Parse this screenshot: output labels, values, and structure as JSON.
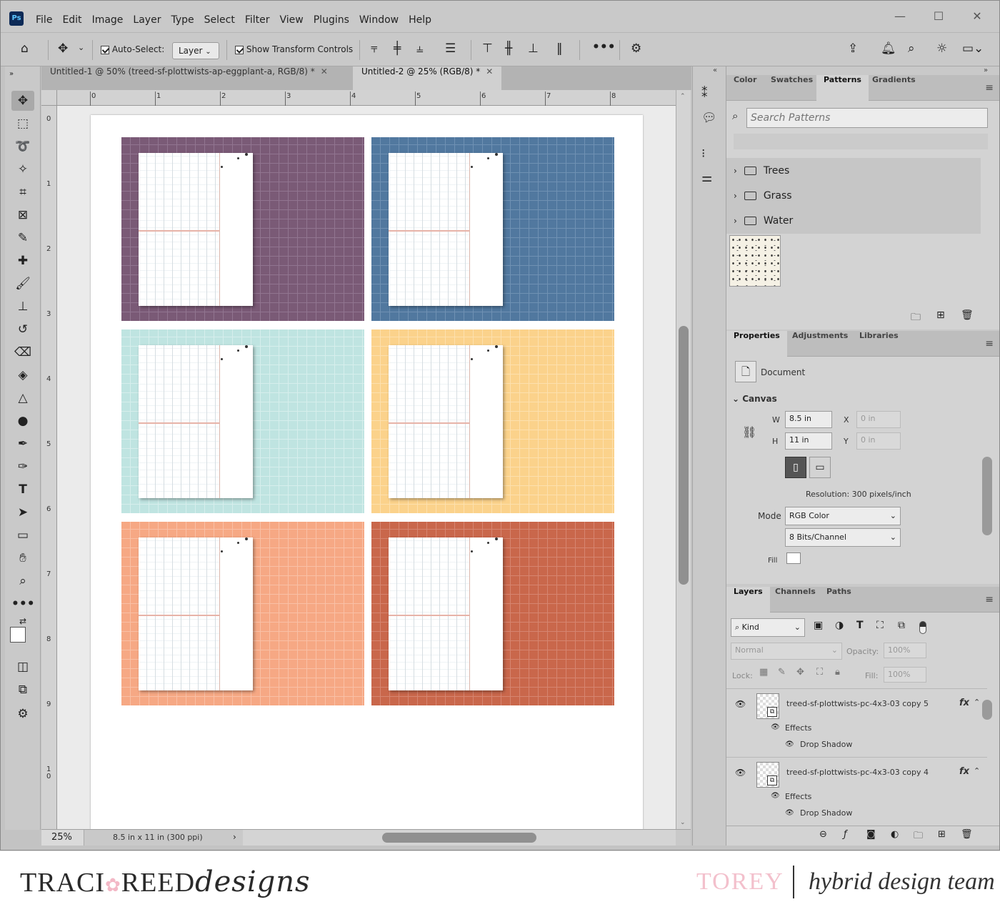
{
  "app": {
    "logo": "Ps",
    "minimize": "—",
    "maximize": "☐",
    "close": "✕"
  },
  "menu": [
    "File",
    "Edit",
    "Image",
    "Layer",
    "Type",
    "Select",
    "Filter",
    "View",
    "Plugins",
    "Window",
    "Help"
  ],
  "options_bar": {
    "auto_select_label": "Auto-Select:",
    "auto_select_checked": true,
    "auto_select_value": "Layer",
    "show_transform_label": "Show Transform Controls",
    "show_transform_checked": true
  },
  "doc_tabs": [
    {
      "label": "Untitled-1 @ 50% (treed-sf-plottwists-ap-eggplant-a, RGB/8) *",
      "active": false
    },
    {
      "label": "Untitled-2 @ 25% (RGB/8) *",
      "active": true
    }
  ],
  "rulers": {
    "h": [
      "0",
      "1",
      "2",
      "3",
      "4",
      "5",
      "6",
      "7",
      "8"
    ],
    "v": [
      "0",
      "1",
      "2",
      "3",
      "4",
      "5",
      "6",
      "7",
      "8",
      "9",
      "1\n0"
    ]
  },
  "cards": [
    {
      "name": "eggplant",
      "bg": "#7a5a76",
      "line": "#917590"
    },
    {
      "name": "blue",
      "bg": "#51789f",
      "line": "#6f91b3"
    },
    {
      "name": "mint",
      "bg": "#bfe4e1",
      "line": "#d6eeec"
    },
    {
      "name": "yellow",
      "bg": "#fbd28b",
      "line": "#fde0ae"
    },
    {
      "name": "peach",
      "bg": "#f6a884",
      "line": "#f9c0a6"
    },
    {
      "name": "rust",
      "bg": "#c9674b",
      "line": "#d68570"
    }
  ],
  "status": {
    "zoom": "25%",
    "doc_info": "8.5 in x 11 in (300 ppi)"
  },
  "color_panel": {
    "tabs": [
      "Color",
      "Swatches",
      "Patterns",
      "Gradients"
    ],
    "active_tab": "Patterns",
    "search_placeholder": "Search Patterns",
    "folders": [
      "Trees",
      "Grass",
      "Water"
    ]
  },
  "properties_panel": {
    "tabs": [
      "Properties",
      "Adjustments",
      "Libraries"
    ],
    "active_tab": "Properties",
    "document_label": "Document",
    "canvas_label": "Canvas",
    "w_label": "W",
    "w_value": "8.5 in",
    "h_label": "H",
    "h_value": "11 in",
    "x_label": "X",
    "x_value": "0 in",
    "y_label": "Y",
    "y_value": "0 in",
    "resolution": "Resolution: 300 pixels/inch",
    "mode_label": "Mode",
    "mode_value": "RGB Color",
    "bits_value": "8 Bits/Channel",
    "fill_label": "Fill"
  },
  "layers_panel": {
    "tabs": [
      "Layers",
      "Channels",
      "Paths"
    ],
    "active_tab": "Layers",
    "kind_label": "Kind",
    "blend_mode": "Normal",
    "opacity_label": "Opacity:",
    "opacity_value": "100%",
    "lock_label": "Lock:",
    "fill_label": "Fill:",
    "fill_value": "100%",
    "layers": [
      {
        "name": "treed-sf-plottwists-pc-4x3-03 copy 5",
        "effects": "Effects",
        "effect": "Drop Shadow",
        "fx": "fx"
      },
      {
        "name": "treed-sf-plottwists-pc-4x3-03 copy 4",
        "effects": "Effects",
        "effect": "Drop Shadow",
        "fx": "fx"
      }
    ]
  },
  "footer": {
    "brand_left": "TRACI",
    "brand_right": "REED",
    "brand_script": "designs",
    "name": "TOREY",
    "team": "hybrid design team"
  }
}
